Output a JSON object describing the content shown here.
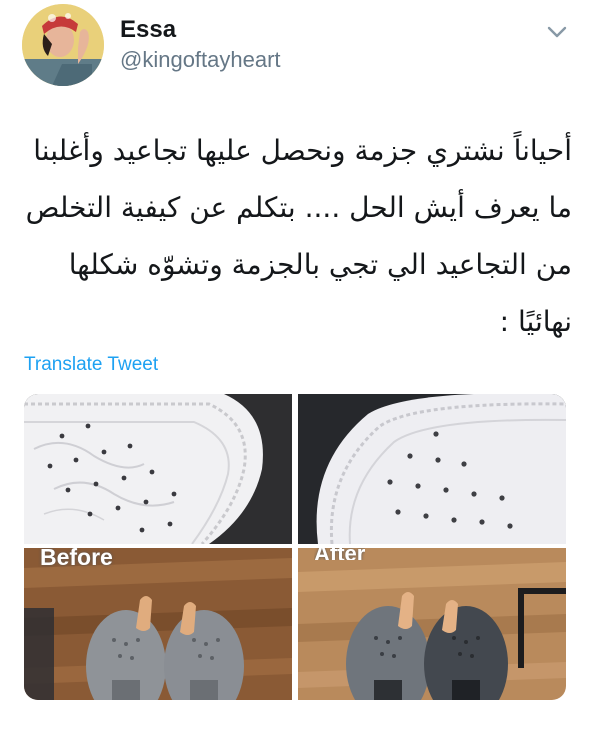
{
  "tweet": {
    "author": {
      "name": "Essa",
      "handle": "@kingoftayheart"
    },
    "text": "أحياناً نشتري جزمة ونحصل عليها تجاعيد وأغلبنا ما يعرف أيش الحل .... بتكلم عن كيفية التخلص من التجاعيد الي تجي بالجزمة وتشوّه شكلها نهائيًا :",
    "translate_label": "Translate Tweet",
    "images": [
      {
        "name": "shoe-toe-wrinkled-closeup"
      },
      {
        "name": "shoe-toe-smooth-closeup"
      },
      {
        "name": "shoes-before",
        "label": "Before"
      },
      {
        "name": "shoes-after",
        "label": "After"
      }
    ]
  },
  "colors": {
    "link": "#1da1f2",
    "secondary_text": "#657786",
    "primary_text": "#14171a"
  }
}
